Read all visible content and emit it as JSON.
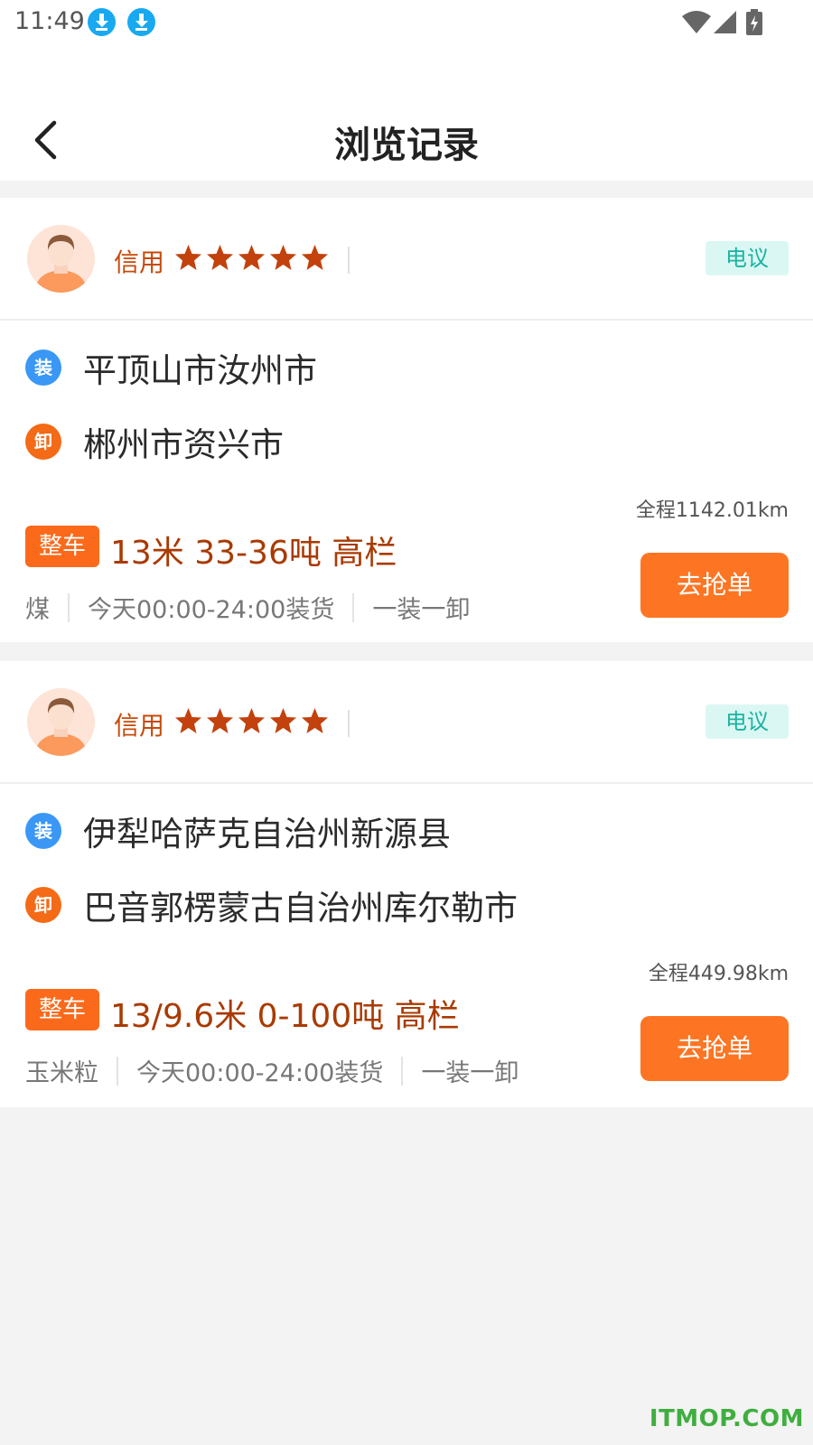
{
  "status_bar": {
    "time": "11:49",
    "icons": [
      "download-icon",
      "download-icon",
      "wifi-icon",
      "signal-icon",
      "battery-charging-icon"
    ]
  },
  "header": {
    "title": "浏览记录",
    "back_icon": "chevron-left-icon"
  },
  "colors": {
    "accent_orange": "#fd7523",
    "cargo_text": "#a93a02",
    "credit_text": "#c74a0a",
    "negotiable_bg": "#dbf7f4",
    "negotiable_text": "#1bb3a0",
    "load_badge": "#3a97f5",
    "unload_badge": "#f46a16"
  },
  "records": [
    {
      "credit_label": "信用",
      "credit_stars": 5,
      "price_tag": "电议",
      "load_badge": "装",
      "load_place": "平顶山市汝州市",
      "unload_badge": "卸",
      "unload_place": "郴州市资兴市",
      "distance": "全程1142.01km",
      "vehicle_type": "整车",
      "cargo_spec": "13米 33-36吨 高栏",
      "goods": "煤",
      "load_time": "今天00:00-24:00装货",
      "load_mode": "一装一卸",
      "action": "去抢单"
    },
    {
      "credit_label": "信用",
      "credit_stars": 5,
      "price_tag": "电议",
      "load_badge": "装",
      "load_place": "伊犁哈萨克自治州新源县",
      "unload_badge": "卸",
      "unload_place": "巴音郭楞蒙古自治州库尔勒市",
      "distance": "全程449.98km",
      "vehicle_type": "整车",
      "cargo_spec": "13/9.6米 0-100吨 高栏",
      "goods": "玉米粒",
      "load_time": "今天00:00-24:00装货",
      "load_mode": "一装一卸",
      "action": "去抢单"
    }
  ],
  "watermark": "ITMOP.COM"
}
